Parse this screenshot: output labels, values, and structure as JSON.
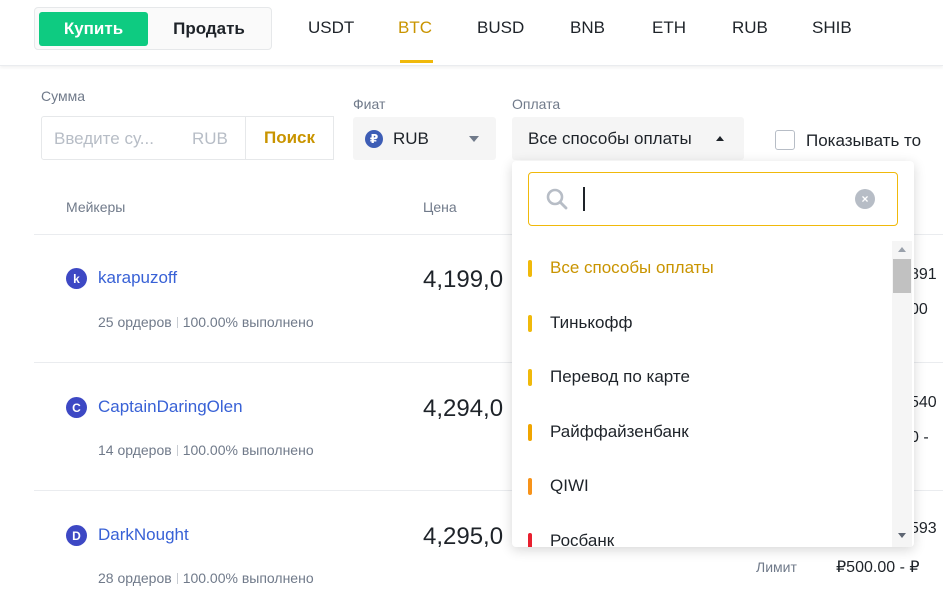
{
  "trade_switch": {
    "buy": "Купить",
    "sell": "Продать"
  },
  "asset_tabs": [
    "USDT",
    "BTC",
    "BUSD",
    "BNB",
    "ETH",
    "RUB",
    "SHIB"
  ],
  "active_asset": "BTC",
  "filters": {
    "amount_label": "Сумма",
    "amount_placeholder": "Введите су...",
    "amount_unit": "RUB",
    "search_button": "Поиск",
    "fiat_label": "Фиат",
    "fiat_value": "RUB",
    "fiat_icon": "₽",
    "payment_label": "Оплата",
    "payment_value": "Все способы оплаты",
    "show_label": "Показывать то"
  },
  "table": {
    "headers": {
      "makers": "Мейкеры",
      "price": "Цена"
    },
    "rows": [
      {
        "initial": "k",
        "name": "karapuzoff",
        "orders": "25 ордеров",
        "completion": "100.00% выполнено",
        "price": "4,199,0",
        "avail_top": "891",
        "avail_bottom": "00"
      },
      {
        "initial": "C",
        "name": "CaptainDaringOlen",
        "orders": "14 ордеров",
        "completion": "100.00% выполнено",
        "price": "4,294,0",
        "avail_top": "540",
        "avail_bottom": "0 -"
      },
      {
        "initial": "D",
        "name": "DarkNought",
        "orders": "28 ордеров",
        "completion": "100.00% выполнено",
        "price": "4,295,0",
        "avail_top": "593",
        "avail_bottom": ""
      }
    ],
    "limit_label": "Лимит",
    "limit_value": "₽500.00 - ₽"
  },
  "payment_dropdown": {
    "search_value": "",
    "clear_icon": "×",
    "items": [
      {
        "label": "Все способы оплаты",
        "color": "#f0b90b",
        "selected": true
      },
      {
        "label": "Тинькофф",
        "color": "#f0b90b",
        "selected": false
      },
      {
        "label": "Перевод по карте",
        "color": "#f0b90b",
        "selected": false
      },
      {
        "label": "Райффайзенбанк",
        "color": "#f0a500",
        "selected": false
      },
      {
        "label": "QIWI",
        "color": "#f7931a",
        "selected": false
      },
      {
        "label": "Росбанк",
        "color": "#e8202f",
        "selected": false
      }
    ]
  },
  "colors": {
    "buy_green": "#0ecb81",
    "accent": "#f0b90b",
    "accent_text": "#c99400",
    "link_blue": "#3861d6"
  }
}
